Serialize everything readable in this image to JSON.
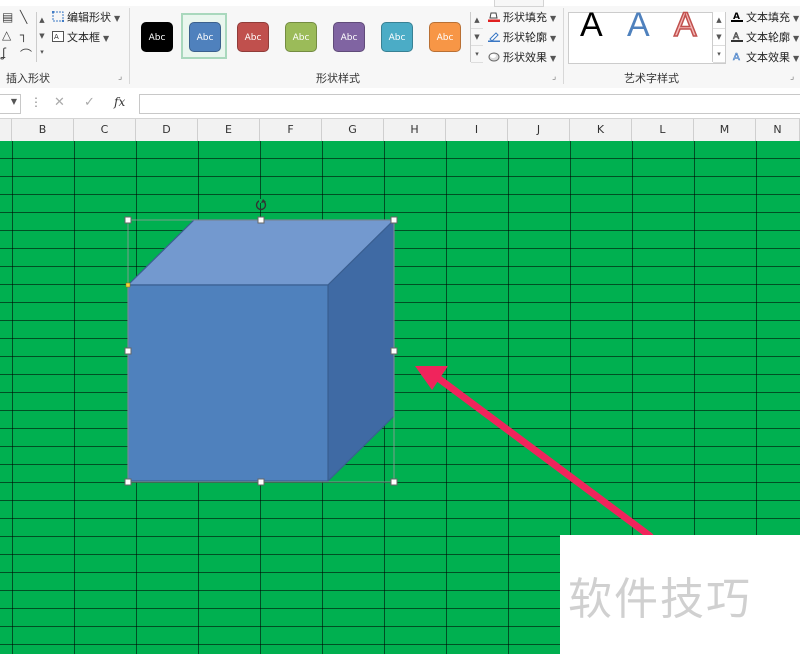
{
  "ribbon": {
    "insert_shapes": {
      "label": "插入形状",
      "edit_shape": "编辑形状",
      "text_box": "文本框"
    },
    "shape_styles": {
      "label": "形状样式",
      "swatch_text": "Abc",
      "swatches": [
        {
          "name": "black",
          "color": "#000000"
        },
        {
          "name": "blue",
          "color": "#4f81bd"
        },
        {
          "name": "red",
          "color": "#c0504d"
        },
        {
          "name": "green",
          "color": "#9bbb59"
        },
        {
          "name": "purple",
          "color": "#8064a2"
        },
        {
          "name": "aqua",
          "color": "#4bacc6"
        },
        {
          "name": "orange",
          "color": "#f79646"
        }
      ],
      "selected": "blue",
      "shape_fill": "形状填充",
      "shape_outline": "形状轮廓",
      "shape_effects": "形状效果"
    },
    "wordart_styles": {
      "label": "艺术字样式",
      "sample": "A",
      "text_fill": "文本填充",
      "text_outline": "文本轮廓",
      "text_effects": "文本效果"
    }
  },
  "formula_bar": {
    "cancel": "✕",
    "enter": "✓",
    "fx": "fx",
    "value": ""
  },
  "columns": [
    "B",
    "C",
    "D",
    "E",
    "F",
    "G",
    "H",
    "I",
    "J",
    "K",
    "L",
    "M",
    "N"
  ],
  "colors": {
    "sheet_fill": "#00b050",
    "cube_front": "#4f81bd",
    "cube_top": "#7399cf",
    "cube_side": "#3f6aa4",
    "arrow": "#f0245c"
  },
  "watermark": "软件技巧"
}
